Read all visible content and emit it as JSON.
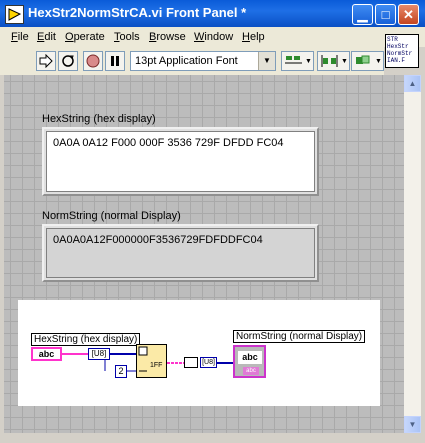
{
  "window": {
    "title": "HexStr2NormStrCA.vi Front Panel *"
  },
  "menu": [
    "File",
    "Edit",
    "Operate",
    "Tools",
    "Browse",
    "Window",
    "Help"
  ],
  "menu_underline": [
    "F",
    "E",
    "O",
    "T",
    "B",
    "W",
    "H"
  ],
  "toolbar": {
    "font": "13pt Application Font"
  },
  "vi_icon_text": [
    "STR",
    "HexStr",
    "NormStr",
    "IAN.F"
  ],
  "hex_control": {
    "label": "HexString (hex display)",
    "value": "0A0A 0A12 F000 000F 3536 729F DFDD FC04"
  },
  "norm_indicator": {
    "label": "NormString (normal Display)",
    "value": "0A0A0A12F000000F3536729FDFDDFC04"
  },
  "diagram": {
    "hex_terminal_label": "HexString (hex display)",
    "norm_terminal_label": "NormString (normal Display)",
    "hex_terminal_text": "abc",
    "norm_terminal_text": "abc",
    "convert_u8": "[U8]",
    "const_two": "2",
    "convert_u8_out": "[U8]",
    "norm_terminal_badge": "abc"
  }
}
